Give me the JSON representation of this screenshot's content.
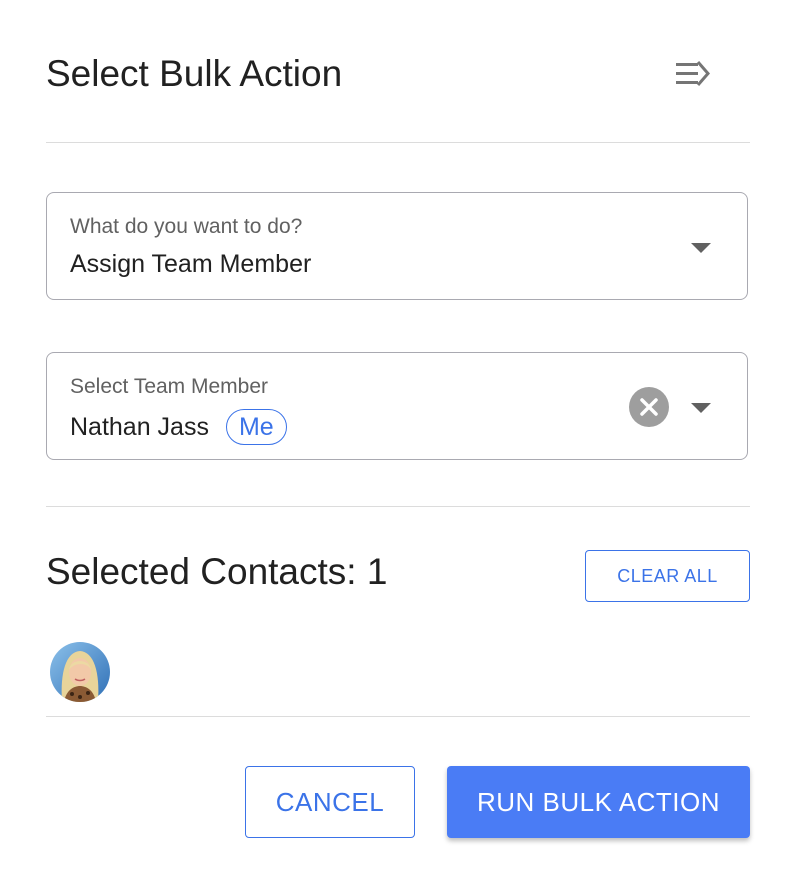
{
  "header": {
    "title": "Select Bulk Action",
    "collapse_icon": "collapse-panel-icon"
  },
  "action_select": {
    "label": "What do you want to do?",
    "value": "Assign Team Member"
  },
  "team_member_select": {
    "label": "Select Team Member",
    "value": "Nathan Jass",
    "chip": "Me"
  },
  "contacts": {
    "title": "Selected Contacts: 1",
    "clear_all_label": "CLEAR ALL"
  },
  "footer": {
    "cancel_label": "CANCEL",
    "run_label": "RUN BULK ACTION"
  },
  "colors": {
    "accent": "#3b73e8",
    "primary_button": "#4a7cf5",
    "divider": "#dcdcdc",
    "field_border": "#a9a9b1"
  }
}
